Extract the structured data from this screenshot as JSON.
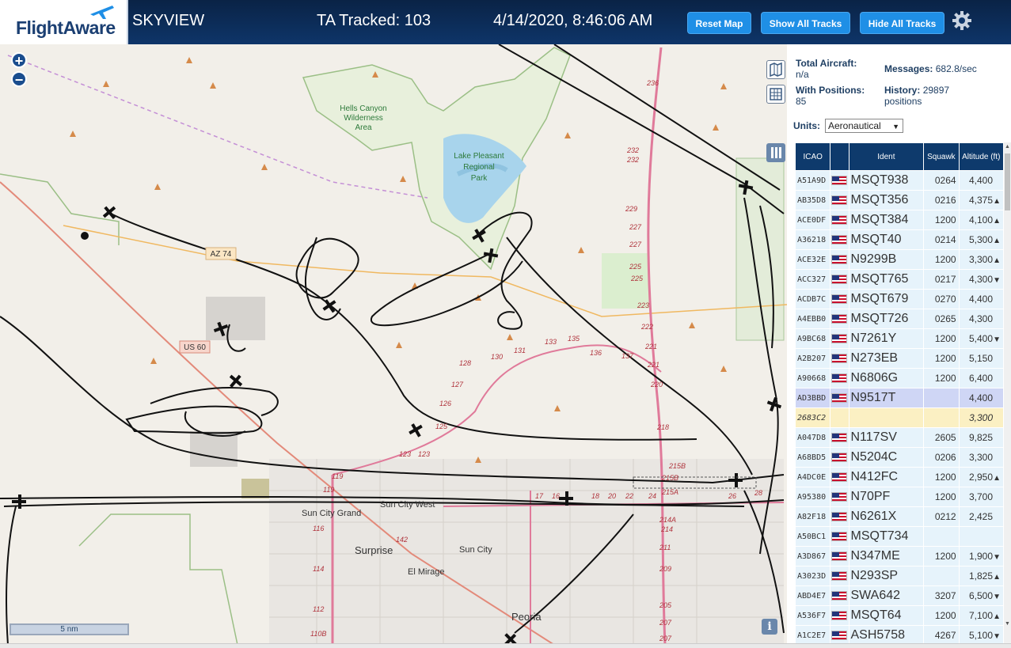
{
  "header": {
    "logo": "FlightAware",
    "site_name": "SKYVIEW",
    "tracked": "TA Tracked: 103",
    "clock": "4/14/2020, 8:46:06 AM",
    "buttons": {
      "reset": "Reset Map",
      "show": "Show All Tracks",
      "hide": "Hide All Tracks"
    },
    "settings_icon": "gear-icon",
    "accent": "#1f8fe6",
    "bg": "#0e3569"
  },
  "map": {
    "labels": {
      "hells_canyon": [
        "Hells Canyon",
        "Wilderness",
        "Area"
      ],
      "lake_pleasant": [
        "Lake Pleasant",
        "Regional",
        "Park"
      ],
      "az74": "AZ 74",
      "us60": "US 60",
      "sun_city_grand": "Sun City Grand",
      "sun_city_west": "Sun City West",
      "surprise": "Surprise",
      "sun_city": "Sun City",
      "el_mirage": "El Mirage",
      "peoria": "Peoria"
    },
    "route_numbers": [
      "236",
      "232",
      "232",
      "229",
      "227",
      "227",
      "225",
      "225",
      "223",
      "222",
      "221",
      "221",
      "220",
      "218",
      "215B",
      "215B",
      "215A",
      "214A",
      "214",
      "211",
      "209",
      "207",
      "205",
      "207",
      "28",
      "26",
      "24",
      "22",
      "20",
      "18",
      "17",
      "16",
      "119",
      "119",
      "116",
      "114",
      "112",
      "110B",
      "142",
      "123",
      "123",
      "125",
      "126",
      "127",
      "128",
      "130",
      "131",
      "133",
      "135",
      "136",
      "137"
    ],
    "scale": "5 nm",
    "zoom_in": "+",
    "zoom_out": "−",
    "info": "i"
  },
  "sidebar": {
    "total_aircraft_label": "Total Aircraft:",
    "total_aircraft": "n/a",
    "messages_label": "Messages:",
    "messages": "682.8/sec",
    "with_positions_label": "With Positions:",
    "with_positions": "85",
    "history_label": "History:",
    "history_value": "29897",
    "history_unit": "positions",
    "units_label": "Units:",
    "units_value": "Aeronautical",
    "columns": [
      "ICAO",
      "",
      "Ident",
      "Squawk",
      "Altitude (ft)"
    ],
    "rows": [
      {
        "icao": "A51A9D",
        "flag": true,
        "ident": "MSQT938",
        "squawk": "0264",
        "alt": "4,400",
        "trend": ""
      },
      {
        "icao": "AB35D8",
        "flag": true,
        "ident": "MSQT356",
        "squawk": "0216",
        "alt": "4,375",
        "trend": "▲"
      },
      {
        "icao": "ACE0DF",
        "flag": true,
        "ident": "MSQT384",
        "squawk": "1200",
        "alt": "4,100",
        "trend": "▲"
      },
      {
        "icao": "A36218",
        "flag": true,
        "ident": "MSQT40",
        "squawk": "0214",
        "alt": "5,300",
        "trend": "▲"
      },
      {
        "icao": "ACE32E",
        "flag": true,
        "ident": "N9299B",
        "squawk": "1200",
        "alt": "3,300",
        "trend": "▲"
      },
      {
        "icao": "ACC327",
        "flag": true,
        "ident": "MSQT765",
        "squawk": "0217",
        "alt": "4,300",
        "trend": "▼"
      },
      {
        "icao": "ACDB7C",
        "flag": true,
        "ident": "MSQT679",
        "squawk": "0270",
        "alt": "4,400",
        "trend": ""
      },
      {
        "icao": "A4EBB0",
        "flag": true,
        "ident": "MSQT726",
        "squawk": "0265",
        "alt": "4,300",
        "trend": ""
      },
      {
        "icao": "A9BC68",
        "flag": true,
        "ident": "N7261Y",
        "squawk": "1200",
        "alt": "5,400",
        "trend": "▼"
      },
      {
        "icao": "A2B207",
        "flag": true,
        "ident": "N273EB",
        "squawk": "1200",
        "alt": "5,150",
        "trend": ""
      },
      {
        "icao": "A90668",
        "flag": true,
        "ident": "N6806G",
        "squawk": "1200",
        "alt": "6,400",
        "trend": ""
      },
      {
        "icao": "AD3BBD",
        "flag": true,
        "ident": "N9517T",
        "squawk": "",
        "alt": "4,400",
        "trend": "",
        "cls": "sel"
      },
      {
        "icao": "2683C2",
        "flag": false,
        "ident": "",
        "squawk": "",
        "alt": "3,300",
        "trend": "",
        "cls": "hl"
      },
      {
        "icao": "A047D8",
        "flag": true,
        "ident": "N117SV",
        "squawk": "2605",
        "alt": "9,825",
        "trend": ""
      },
      {
        "icao": "A68BD5",
        "flag": true,
        "ident": "N5204C",
        "squawk": "0206",
        "alt": "3,300",
        "trend": ""
      },
      {
        "icao": "A4DC0E",
        "flag": true,
        "ident": "N412FC",
        "squawk": "1200",
        "alt": "2,950",
        "trend": "▲"
      },
      {
        "icao": "A95380",
        "flag": true,
        "ident": "N70PF",
        "squawk": "1200",
        "alt": "3,700",
        "trend": ""
      },
      {
        "icao": "A82F18",
        "flag": true,
        "ident": "N6261X",
        "squawk": "0212",
        "alt": "2,425",
        "trend": ""
      },
      {
        "icao": "A50BC1",
        "flag": true,
        "ident": "MSQT734",
        "squawk": "",
        "alt": "",
        "trend": ""
      },
      {
        "icao": "A3D867",
        "flag": true,
        "ident": "N347ME",
        "squawk": "1200",
        "alt": "1,900",
        "trend": "▼"
      },
      {
        "icao": "A3023D",
        "flag": true,
        "ident": "N293SP",
        "squawk": "",
        "alt": "1,825",
        "trend": "▲"
      },
      {
        "icao": "ABD4E7",
        "flag": true,
        "ident": "SWA642",
        "squawk": "3207",
        "alt": "6,500",
        "trend": "▼"
      },
      {
        "icao": "A536F7",
        "flag": true,
        "ident": "MSQT64",
        "squawk": "1200",
        "alt": "7,100",
        "trend": "▲"
      },
      {
        "icao": "A1C2E7",
        "flag": true,
        "ident": "ASH5758",
        "squawk": "4267",
        "alt": "5,100",
        "trend": "▼"
      }
    ]
  }
}
